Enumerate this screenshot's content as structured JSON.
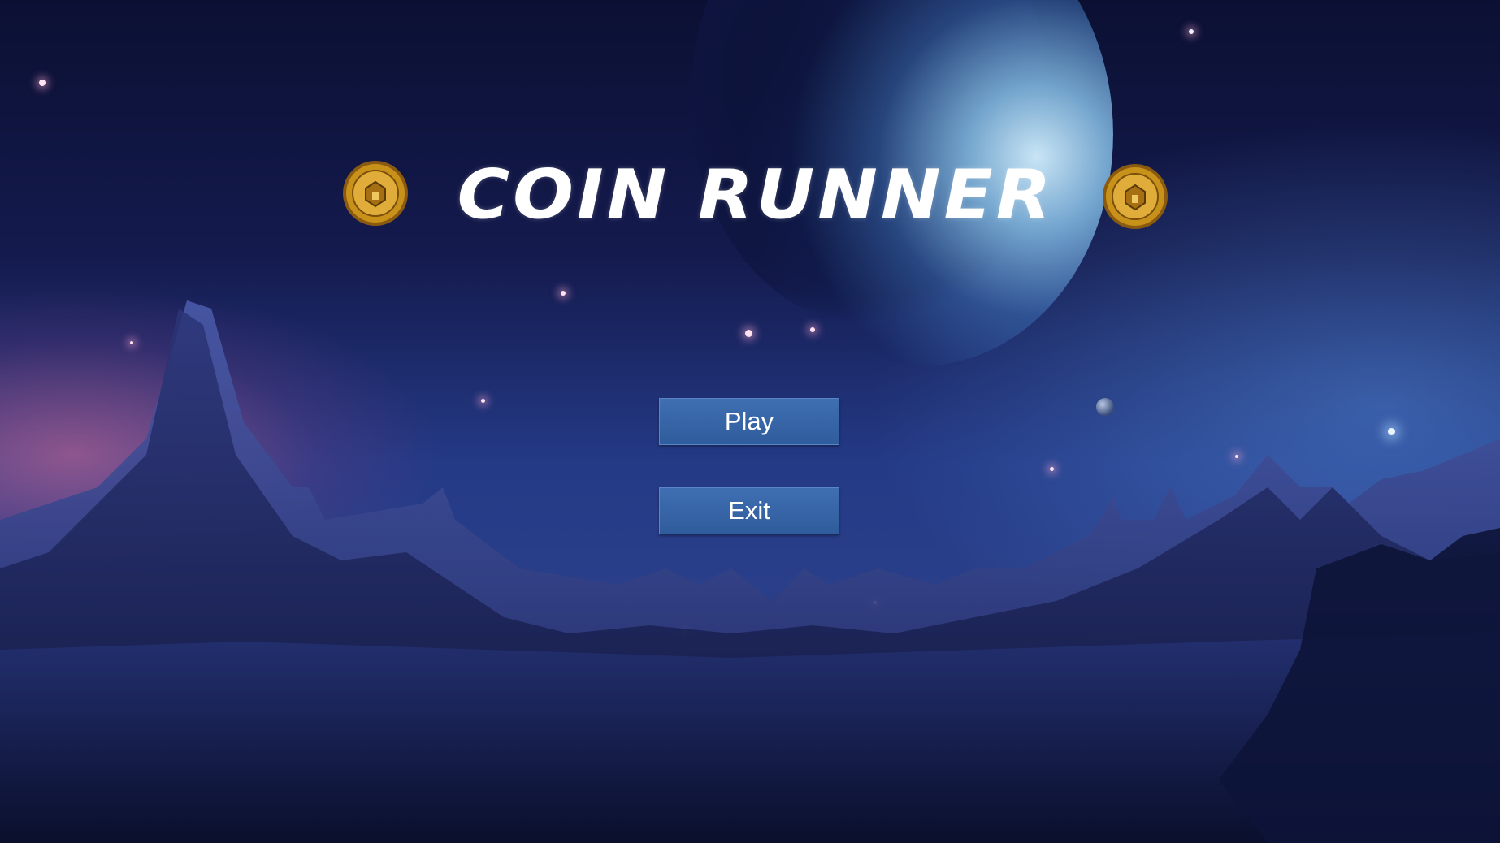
{
  "game": {
    "title": "COIN RUNNER",
    "menu": {
      "play_label": "Play",
      "exit_label": "Exit"
    }
  },
  "colors": {
    "button_fill": "#3a68aa",
    "button_text": "#ffffff",
    "title_text": "#ffffff",
    "coin_gold": "#c8921a"
  },
  "icons": {
    "left_emblem": "gold-coin-icon",
    "right_emblem": "gold-coin-icon"
  }
}
